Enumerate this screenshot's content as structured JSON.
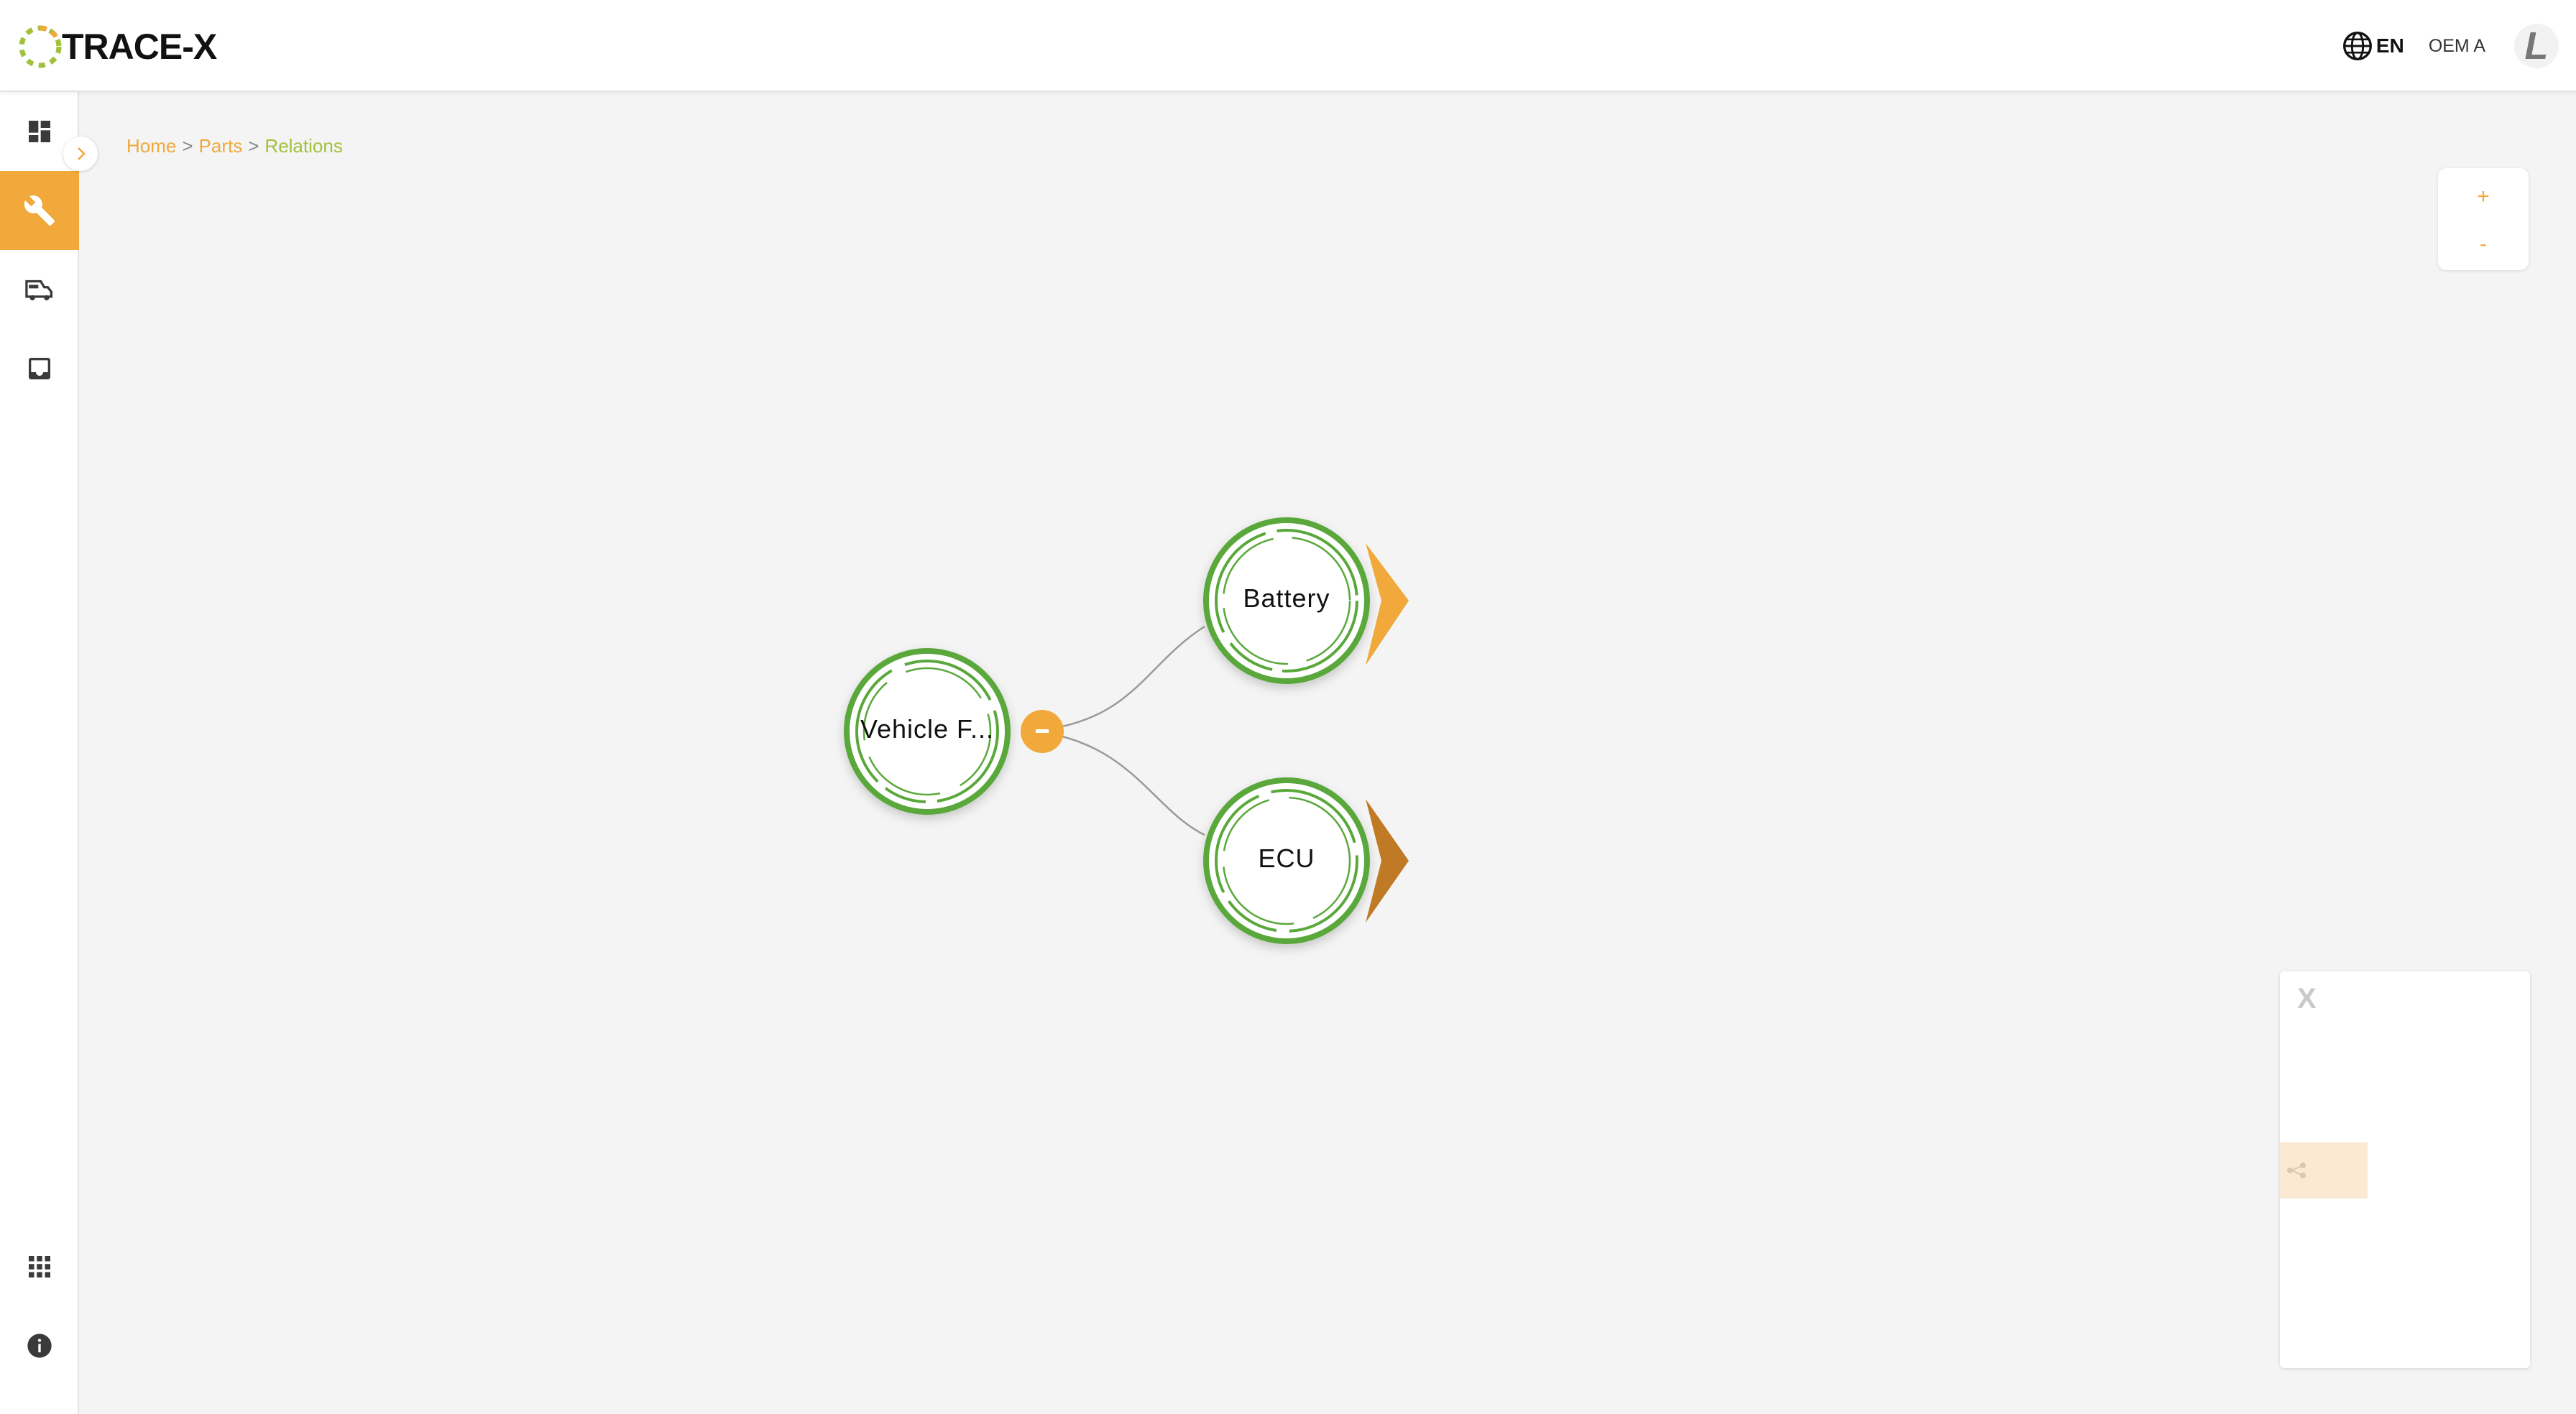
{
  "app": {
    "name": "TRACE-X",
    "language": "EN",
    "user": "OEM A",
    "avatar_initial": "L"
  },
  "sidebar": {
    "items": [
      {
        "name": "dashboard",
        "icon": "dashboard-icon",
        "active": false
      },
      {
        "name": "parts",
        "icon": "wrench-icon",
        "active": true
      },
      {
        "name": "other-parts",
        "icon": "vehicles-icon",
        "active": false
      },
      {
        "name": "notifications",
        "icon": "inbox-icon",
        "active": false
      }
    ],
    "bottom_items": [
      {
        "name": "apps",
        "icon": "apps-grid-icon"
      },
      {
        "name": "about",
        "icon": "info-icon"
      }
    ]
  },
  "breadcrumb": [
    {
      "label": "Home"
    },
    {
      "label": "Parts"
    },
    {
      "label": "Relations"
    }
  ],
  "breadcrumb_separator": ">",
  "zoom": {
    "in_label": "+",
    "out_label": "-"
  },
  "graph": {
    "root": {
      "label": "Vehicle F...",
      "collapse_label": "-"
    },
    "children": [
      {
        "label": "Battery",
        "arrow_color": "#f0a93a"
      },
      {
        "label": "ECU",
        "arrow_color": "#c07a26"
      }
    ]
  },
  "minimap": {
    "close_label": "X"
  },
  "colors": {
    "accent": "#f0a93a",
    "node_ring": "#5aa83c",
    "breadcrumb_current": "#a2c13b"
  }
}
